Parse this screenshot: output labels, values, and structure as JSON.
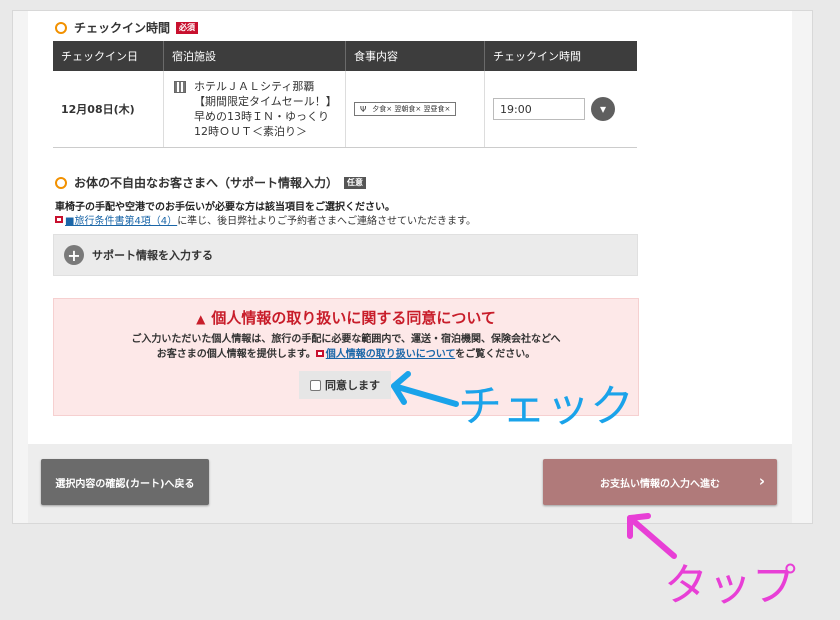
{
  "checkin_section": {
    "title": "チェックイン時間",
    "required_tag": "必須",
    "table": {
      "headers": [
        "チェックイン日",
        "宿泊施設",
        "食事内容",
        "チェックイン時間"
      ],
      "row": {
        "date": "12月08日(木)",
        "hotel_lines": [
          "ホテルＪＡＬシティ那覇",
          "【期間限定タイムセール！】",
          "早めの13時ＩＮ・ゆっくり",
          "12時ＯＵＴ＜素泊り＞"
        ],
        "meal": "夕食×  翌朝食×  翌昼食×",
        "time": "19:00"
      }
    }
  },
  "support_section": {
    "title": "お体の不自由なお客さまへ（サポート情報入力）",
    "optional_tag": "任意",
    "text": "車椅子の手配や空港でのお手伝いが必要な方は該当項目をご選択ください。",
    "note_link": "■旅行条件書第4項（4）",
    "note_rest": "に準じ、後日弊社よりご予約者さまへご連絡させていただきます。",
    "bar_label": "サポート情報を入力する"
  },
  "consent": {
    "title": "個人情報の取り扱いに関する同意について",
    "line1": "ご入力いただいた個人情報は、旅行の手配に必要な範囲内で、運送・宿泊機関、保険会社などへ",
    "line2_pre": "お客さまの個人情報を提供します。",
    "line2_link": "個人情報の取り扱いについて",
    "line2_post": "をご覧ください。",
    "agree_label": "同意します"
  },
  "buttons": {
    "back": "選択内容の確認(カート)へ戻る",
    "next": "お支払い情報の入力へ進む"
  },
  "annotations": {
    "check": "チェック",
    "tap": "タップ",
    "check_color": "#1aa3ea",
    "tap_color": "#e83fd6"
  },
  "colors": {
    "accent_orange": "#f29100",
    "required_red": "#c8102e",
    "consent_bg": "#fde8e8",
    "next_button": "#b07a7a"
  }
}
